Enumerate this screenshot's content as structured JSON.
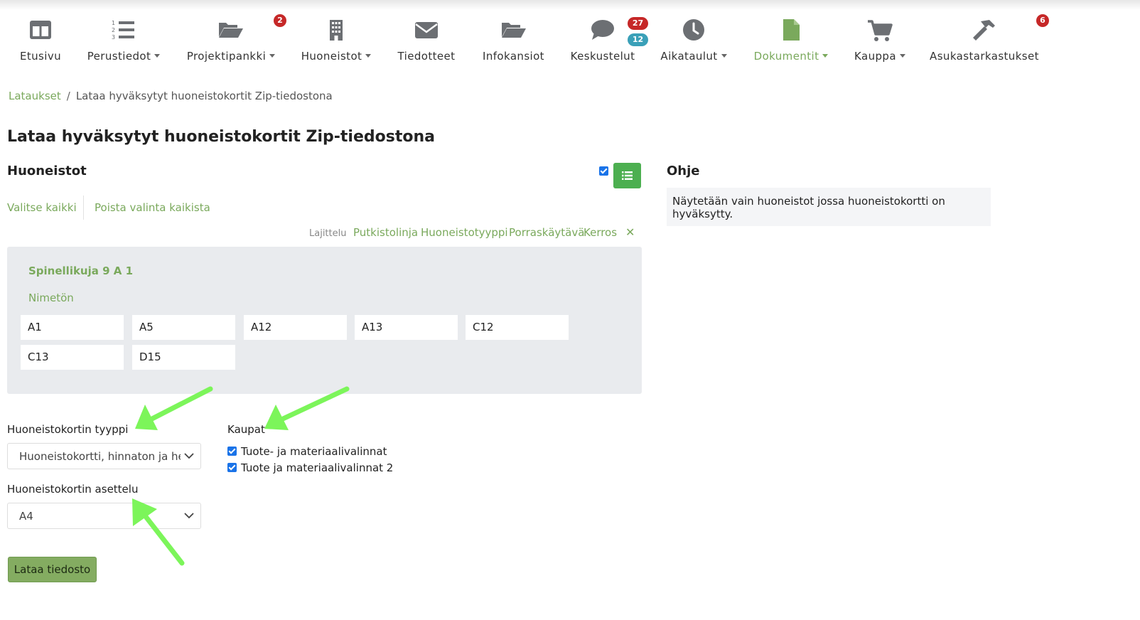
{
  "nav": {
    "items": [
      {
        "label": "Etusivu",
        "icon": "layout-columns-icon"
      },
      {
        "label": "Perustiedot",
        "icon": "numbered-list-icon",
        "dropdown": true
      },
      {
        "label": "Projektipankki",
        "icon": "folder-open-icon",
        "dropdown": true,
        "badge": "2"
      },
      {
        "label": "Huoneistot",
        "icon": "building-icon",
        "dropdown": true
      },
      {
        "label": "Tiedotteet",
        "icon": "envelope-icon"
      },
      {
        "label": "Infokansiot",
        "icon": "folder-open-icon"
      },
      {
        "label": "Keskustelut",
        "icon": "chat-bubble-icon",
        "badge": "27",
        "badge2": "12"
      },
      {
        "label": "Aikataulut",
        "icon": "clock-icon",
        "dropdown": true
      },
      {
        "label": "Dokumentit",
        "icon": "document-icon",
        "dropdown": true,
        "active": true
      },
      {
        "label": "Kauppa",
        "icon": "shopping-cart-icon",
        "dropdown": true
      },
      {
        "label": "Asukastarkastukset",
        "icon": "hammer-icon",
        "badge": "6"
      }
    ]
  },
  "breadcrumb": {
    "root": "Lataukset",
    "separator": "/",
    "current": "Lataa hyväksytyt huoneistokortit Zip-tiedostona"
  },
  "page": {
    "title": "Lataa hyväksytyt huoneistokortit Zip-tiedostona"
  },
  "apartments": {
    "heading": "Huoneistot",
    "select_all": "Valitse kaikki",
    "deselect_all": "Poista valinta kaikista",
    "sorting_label": "Lajittelu",
    "sort_options": [
      "Putkistolinja",
      "Huoneistotyyppi",
      "Porraskäytävä",
      "Kerros"
    ],
    "clear_symbol": "✕",
    "address": "Spinellikuja 9 A 1",
    "group": "Nimetön",
    "items": [
      "A1",
      "A5",
      "A12",
      "A13",
      "C12",
      "C13",
      "D15"
    ]
  },
  "form": {
    "card_type_label": "Huoneistokortin tyyppi",
    "card_type_value": "Huoneistokortti, hinnaton ja hei",
    "layout_label": "Huoneistokortin asettelu",
    "layout_value": "A4",
    "shops_label": "Kaupat",
    "shops": [
      "Tuote- ja materiaalivalinnat",
      "Tuote ja materiaalivalinnat 2"
    ],
    "submit": "Lataa tiedosto"
  },
  "help": {
    "heading": "Ohje",
    "text": "Näytetään vain huoneistot jossa huoneistokortti on hyväksytty."
  },
  "colors": {
    "accent": "#7aa95c",
    "button_green": "#4caf50",
    "badge_red": "#c62828",
    "badge_teal": "#3aa0b8",
    "arrow": "#7cf55a",
    "icon_gray": "#6c6f73"
  }
}
